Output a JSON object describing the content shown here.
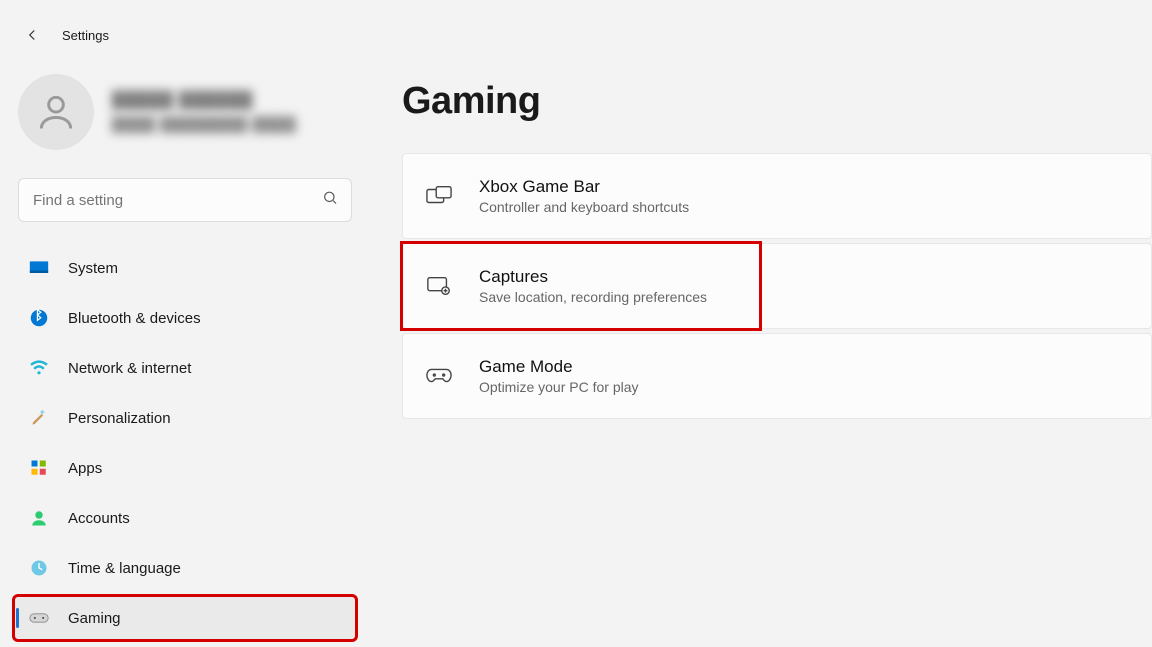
{
  "app_title": "Settings",
  "profile": {
    "name": "█████ ██████",
    "email": "████ ████████ ████"
  },
  "search": {
    "placeholder": "Find a setting"
  },
  "sidebar": {
    "items": [
      {
        "label": "System"
      },
      {
        "label": "Bluetooth & devices"
      },
      {
        "label": "Network & internet"
      },
      {
        "label": "Personalization"
      },
      {
        "label": "Apps"
      },
      {
        "label": "Accounts"
      },
      {
        "label": "Time & language"
      },
      {
        "label": "Gaming"
      }
    ]
  },
  "page": {
    "title": "Gaming"
  },
  "cards": [
    {
      "title": "Xbox Game Bar",
      "sub": "Controller and keyboard shortcuts"
    },
    {
      "title": "Captures",
      "sub": "Save location, recording preferences"
    },
    {
      "title": "Game Mode",
      "sub": "Optimize your PC for play"
    }
  ]
}
